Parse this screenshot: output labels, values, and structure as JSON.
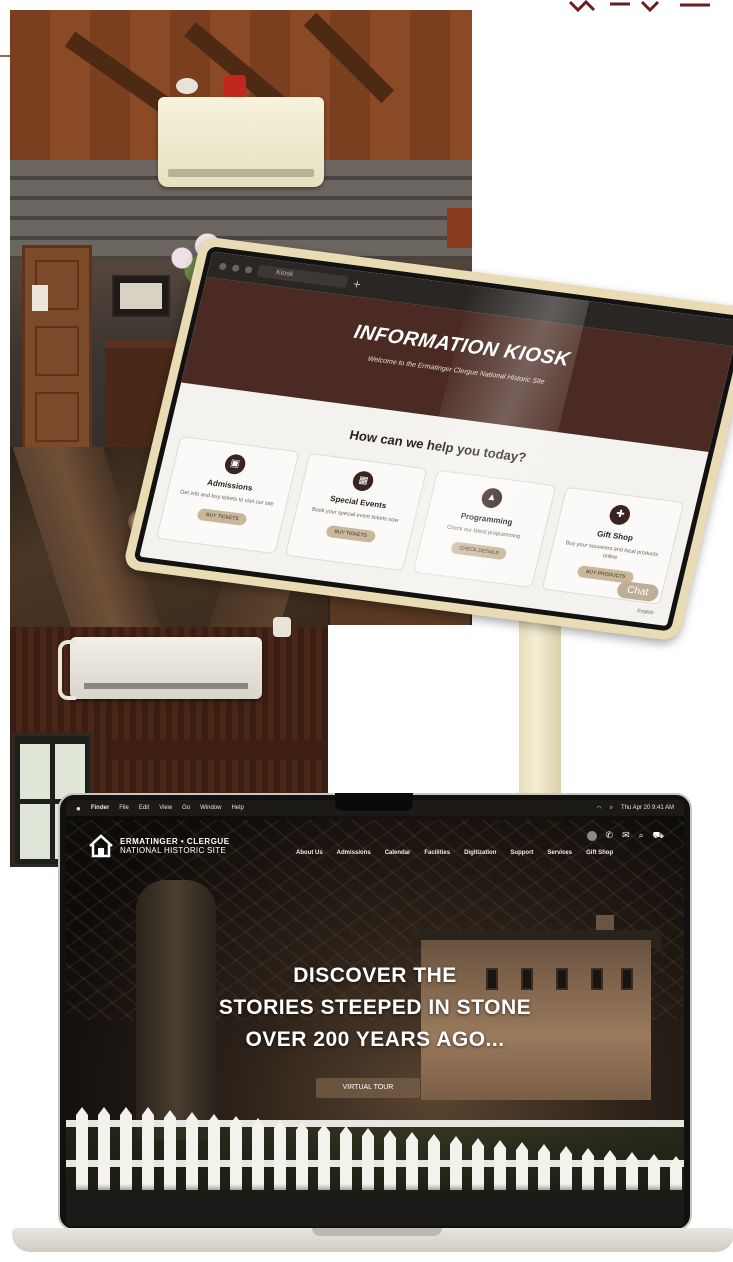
{
  "colors": {
    "kiosk_hero": "#4a2a22",
    "kiosk_button": "#c9b79c",
    "laptop_bg": "#111111",
    "accent_brown": "#786048"
  },
  "kiosk": {
    "browser_tab": "Kiosk",
    "title": "INFORMATION KIOSK",
    "subtitle": "Welcome to the Ermatinger Clergue National Historic Site",
    "help_heading": "How can we help you today?",
    "cards": [
      {
        "icon": "ticket-icon",
        "title": "Admissions",
        "desc": "Get info and buy tickets to visit our site",
        "button": "BUY TICKETS"
      },
      {
        "icon": "calendar-icon",
        "title": "Special Events",
        "desc": "Book your special event tickets now",
        "button": "BUY TICKETS"
      },
      {
        "icon": "graduation-cap-icon",
        "title": "Programming",
        "desc": "Check our latest programming",
        "button": "CHECK DETAILS"
      },
      {
        "icon": "gift-icon",
        "title": "Gift Shop",
        "desc": "Buy your souvenirs and local products online",
        "button": "BUY PRODUCTS"
      }
    ],
    "chat_label": "Chat",
    "language": "English"
  },
  "laptop": {
    "menubar": {
      "apple": "",
      "items": [
        "Finder",
        "File",
        "Edit",
        "View",
        "Go",
        "Window",
        "Help"
      ],
      "clock": "Thu Apr 20 9:41 AM"
    },
    "site": {
      "logo_line1": "ERMATINGER • CLERGUE",
      "logo_line2": "NATIONAL HISTORIC SITE",
      "nav": [
        "About Us",
        "Admissions",
        "Calendar",
        "Facilities",
        "Digitization",
        "Support",
        "Services",
        "Gift Shop"
      ],
      "hero_lines": [
        "DISCOVER THE",
        "STORIES STEEPED IN STONE",
        "OVER 200 YEARS AGO..."
      ],
      "tour_button": "VIRTUAL TOUR"
    }
  }
}
